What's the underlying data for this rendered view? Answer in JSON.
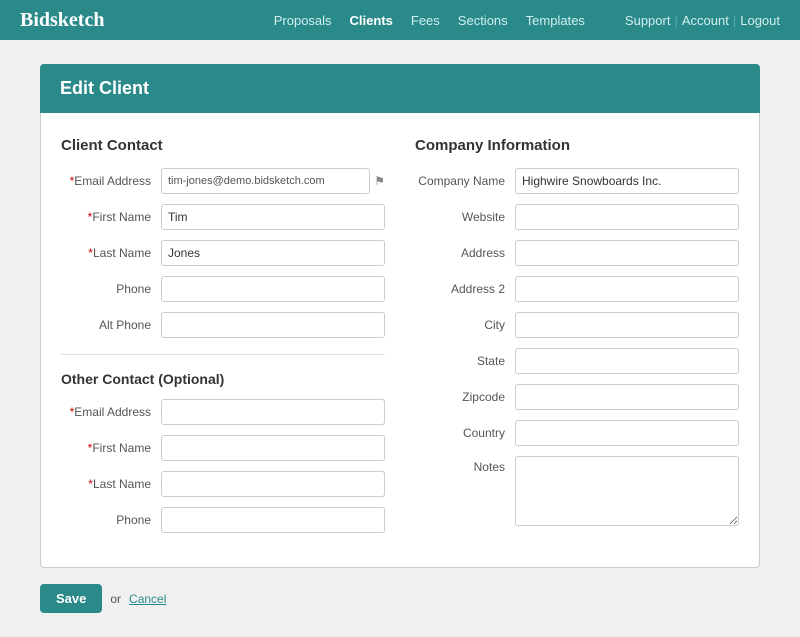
{
  "nav": {
    "logo": "Bidsketch",
    "links": [
      {
        "label": "Proposals",
        "active": false,
        "href": "#"
      },
      {
        "label": "Clients",
        "active": true,
        "href": "#"
      },
      {
        "label": "Fees",
        "active": false,
        "href": "#"
      },
      {
        "label": "Sections",
        "active": false,
        "href": "#"
      },
      {
        "label": "Templates",
        "active": false,
        "href": "#"
      }
    ],
    "right_links": [
      {
        "label": "Support"
      },
      {
        "label": "Account"
      },
      {
        "label": "Logout"
      }
    ]
  },
  "page": {
    "header": "Edit Client",
    "client_contact": {
      "title": "Client Contact",
      "fields": [
        {
          "label": "*Email Address",
          "required": true,
          "name": "email",
          "value": "tim-jones@demo.bidsketch.com",
          "type": "email",
          "has_icon": true
        },
        {
          "label": "*First Name",
          "required": true,
          "name": "first_name",
          "value": "Tim",
          "type": "text"
        },
        {
          "label": "*Last Name",
          "required": true,
          "name": "last_name",
          "value": "Jones",
          "type": "text"
        },
        {
          "label": "Phone",
          "required": false,
          "name": "phone",
          "value": "",
          "type": "text"
        },
        {
          "label": "Alt Phone",
          "required": false,
          "name": "alt_phone",
          "value": "",
          "type": "text"
        }
      ]
    },
    "other_contact": {
      "title": "Other Contact (Optional)",
      "fields": [
        {
          "label": "*Email Address",
          "required": true,
          "name": "other_email",
          "value": "",
          "type": "email"
        },
        {
          "label": "*First Name",
          "required": true,
          "name": "other_first_name",
          "value": "",
          "type": "text"
        },
        {
          "label": "*Last Name",
          "required": true,
          "name": "other_last_name",
          "value": "",
          "type": "text"
        },
        {
          "label": "Phone",
          "required": false,
          "name": "other_phone",
          "value": "",
          "type": "text"
        }
      ]
    },
    "company_info": {
      "title": "Company Information",
      "fields": [
        {
          "label": "Company Name",
          "name": "company_name",
          "value": "Highwire Snowboards Inc.",
          "type": "text"
        },
        {
          "label": "Website",
          "name": "website",
          "value": "",
          "type": "text"
        },
        {
          "label": "Address",
          "name": "address",
          "value": "",
          "type": "text"
        },
        {
          "label": "Address 2",
          "name": "address2",
          "value": "",
          "type": "text"
        },
        {
          "label": "City",
          "name": "city",
          "value": "",
          "type": "text"
        },
        {
          "label": "State",
          "name": "state",
          "value": "",
          "type": "text"
        },
        {
          "label": "Zipcode",
          "name": "zipcode",
          "value": "",
          "type": "text"
        },
        {
          "label": "Country",
          "name": "country",
          "value": "",
          "type": "text"
        },
        {
          "label": "Notes",
          "name": "notes",
          "value": "",
          "type": "textarea"
        }
      ]
    },
    "save_button": "Save",
    "cancel_label": "or",
    "cancel_link": "Cancel"
  }
}
